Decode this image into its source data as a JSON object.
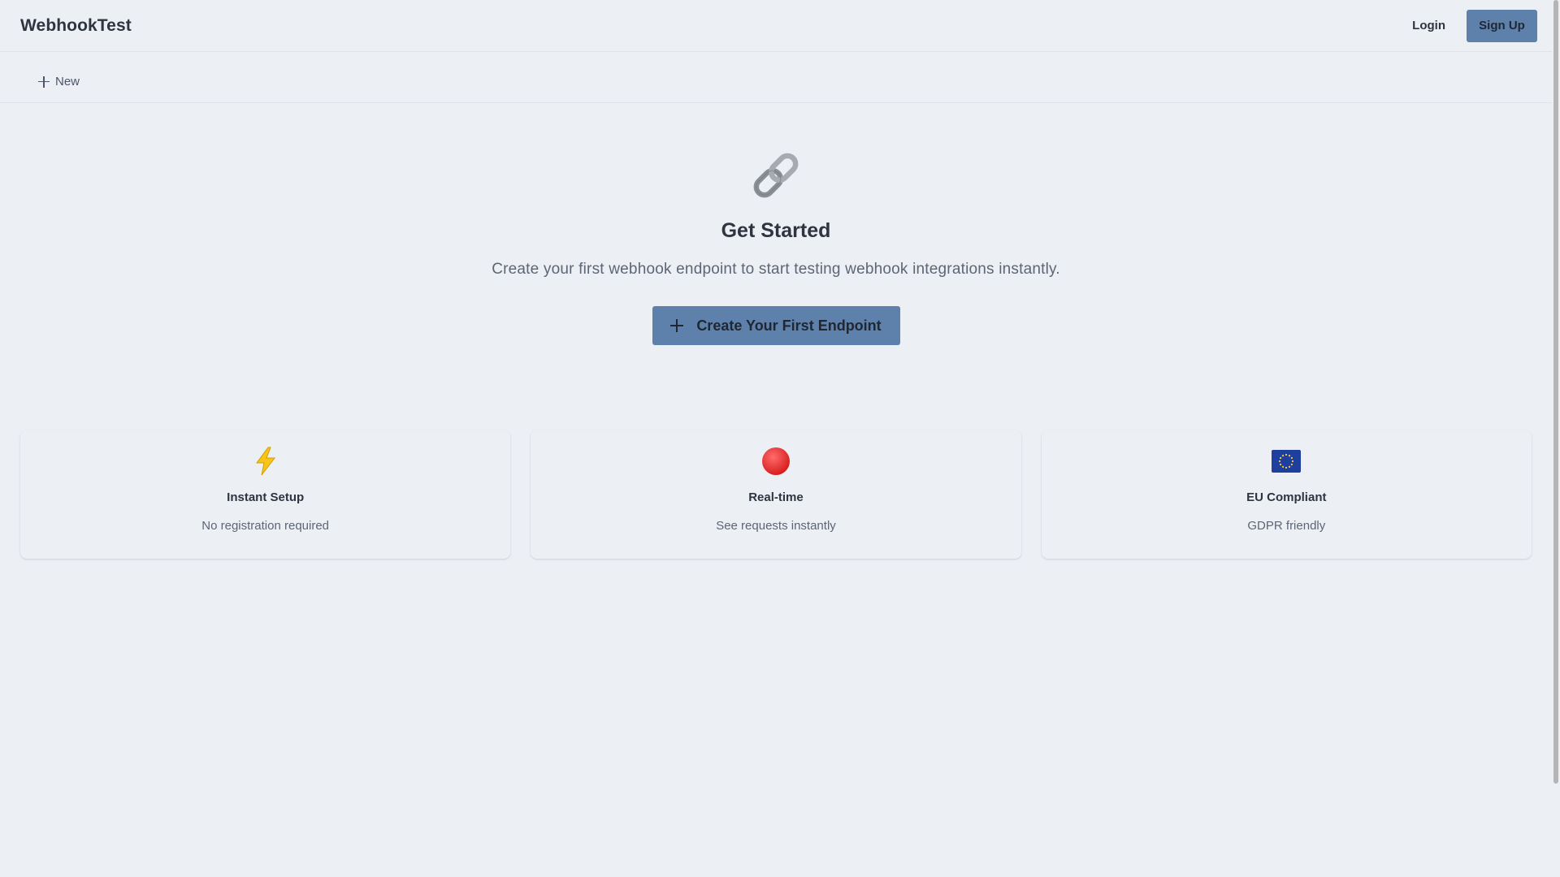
{
  "header": {
    "brand": "WebhookTest",
    "login_label": "Login",
    "signup_label": "Sign Up"
  },
  "tabs": {
    "new_label": "New"
  },
  "hero": {
    "icon": "link-icon",
    "title": "Get Started",
    "subtitle": "Create your first webhook endpoint to start testing webhook integrations instantly.",
    "cta_label": "Create Your First Endpoint"
  },
  "features": [
    {
      "icon": "lightning-icon",
      "title": "Instant Setup",
      "description": "No registration required"
    },
    {
      "icon": "red-circle-icon",
      "title": "Real-time",
      "description": "See requests instantly"
    },
    {
      "icon": "eu-flag-icon",
      "title": "EU Compliant",
      "description": "GDPR friendly"
    }
  ],
  "colors": {
    "background": "#eceff4",
    "accent": "#5e81ac",
    "text": "#2e3440",
    "muted_text": "#5c6676"
  }
}
